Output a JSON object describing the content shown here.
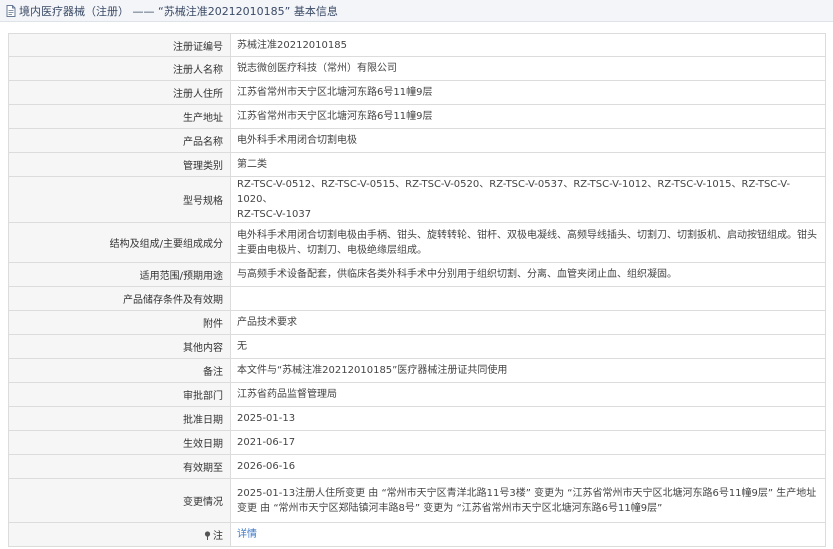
{
  "header": {
    "title": "境内医疗器械（注册） —— “苏械注准20212010185” 基本信息"
  },
  "rows": [
    {
      "label": "注册证编号",
      "value": "苏械注准20212010185"
    },
    {
      "label": "注册人名称",
      "value": "锐志微创医疗科技（常州）有限公司"
    },
    {
      "label": "注册人住所",
      "value": "江苏省常州市天宁区北塘河东路6号11幢9层"
    },
    {
      "label": "生产地址",
      "value": "江苏省常州市天宁区北塘河东路6号11幢9层"
    },
    {
      "label": "产品名称",
      "value": "电外科手术用闭合切割电极"
    },
    {
      "label": "管理类别",
      "value": "第二类"
    },
    {
      "label": "型号规格",
      "line1": "RZ-TSC-V-0512、RZ-TSC-V-0515、RZ-TSC-V-0520、RZ-TSC-V-0537、RZ-TSC-V-1012、RZ-TSC-V-1015、RZ-TSC-V-1020、",
      "line2": "RZ-TSC-V-1037"
    },
    {
      "label": "结构及组成/主要组成成分",
      "line1": "电外科手术用闭合切割电极由手柄、钳头、旋转转轮、钳杆、双极电凝线、高频导线插头、切割刀、切割扳机、启动按钮组成。钳头",
      "line2": "主要由电极片、切割刀、电极绝缘层组成。"
    },
    {
      "label": "适用范围/预期用途",
      "value": "与高频手术设备配套，供临床各类外科手术中分别用于组织切割、分离、血管夹闭止血、组织凝固。"
    },
    {
      "label": "产品储存条件及有效期",
      "value": ""
    },
    {
      "label": "附件",
      "value": "产品技术要求"
    },
    {
      "label": "其他内容",
      "value": "无"
    },
    {
      "label": "备注",
      "value": "本文件与“苏械注准20212010185”医疗器械注册证共同使用"
    },
    {
      "label": "审批部门",
      "value": "江苏省药品监督管理局"
    },
    {
      "label": "批准日期",
      "value": "2025-01-13"
    },
    {
      "label": "生效日期",
      "value": "2021-06-17"
    },
    {
      "label": "有效期至",
      "value": "2026-06-16"
    },
    {
      "label": "变更情况",
      "line1": "2025-01-13注册人住所变更 由 “常州市天宁区青洋北路11号3楼” 变更为 “江苏省常州市天宁区北塘河东路6号11幢9层” 生产地址",
      "line2": "变更 由 “常州市天宁区郑陆镇河丰路8号” 变更为 “江苏省常州市天宁区北塘河东路6号11幢9层”"
    },
    {
      "label": "注",
      "value": "详情"
    }
  ],
  "icons": {
    "header": "document-icon",
    "note": "pin-icon"
  },
  "colors": {
    "link": "#3f78c8",
    "label_bg": "#f6f6f6",
    "header_bg": "#f3f5f8"
  }
}
